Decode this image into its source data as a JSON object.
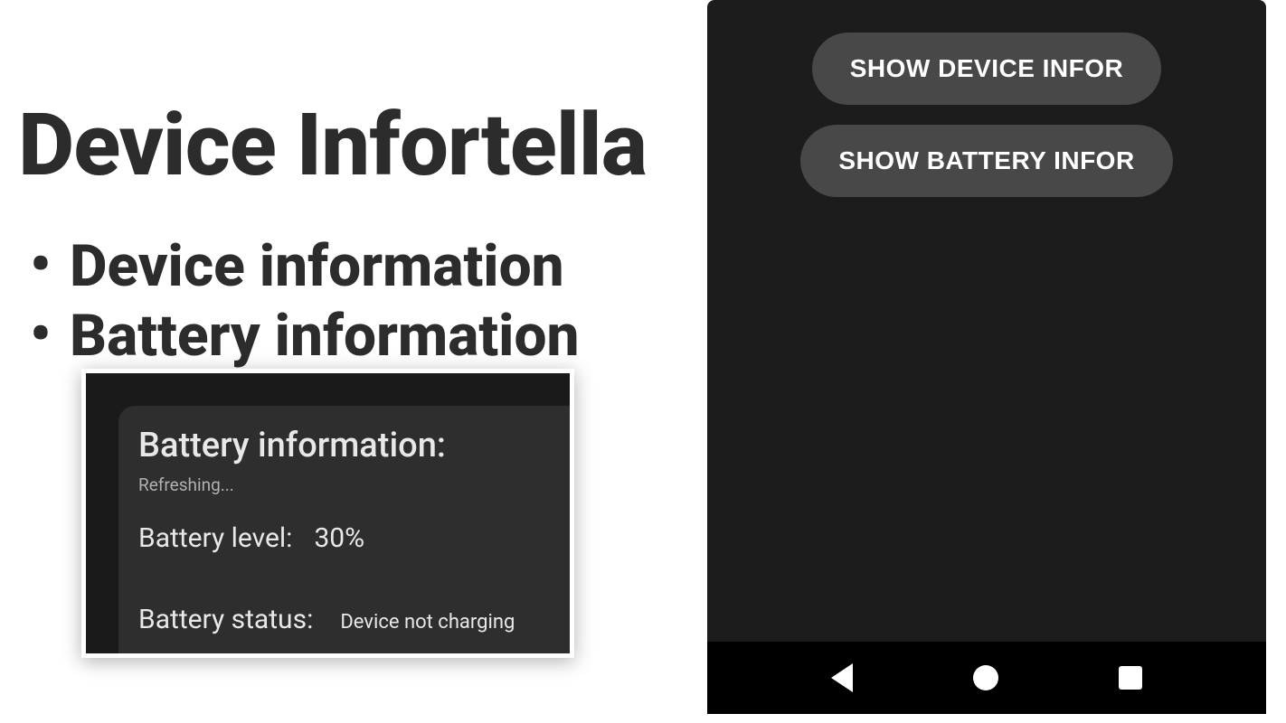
{
  "main": {
    "title": "Device Infortella",
    "bullets": [
      "Device information",
      "Battery information"
    ]
  },
  "battery_card": {
    "heading": "Battery information:",
    "refreshing": "Refreshing...",
    "level_label": "Battery level:",
    "level_value": "30%",
    "status_label": "Battery status:",
    "status_value": "Device not charging"
  },
  "phone": {
    "buttons": {
      "device_info": "SHOW DEVICE INFOR",
      "battery_info": "SHOW BATTERY INFOR"
    }
  }
}
